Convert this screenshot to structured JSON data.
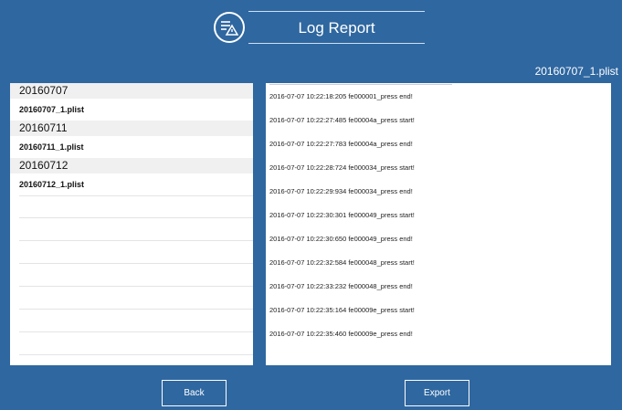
{
  "header": {
    "title": "Log Report",
    "logo_icon": "log-list-warning-icon"
  },
  "current_file": "20160707_1.plist",
  "file_groups": [
    {
      "date": "20160707",
      "files": [
        "20160707_1.plist"
      ]
    },
    {
      "date": "20160711",
      "files": [
        "20160711_1.plist"
      ]
    },
    {
      "date": "20160712",
      "files": [
        "20160712_1.plist"
      ]
    }
  ],
  "log_entries": [
    "2016-07-07 10:22:18:205 fe000001_press end!",
    "2016-07-07 10:22:27:485 fe00004a_press start!",
    "2016-07-07 10:22:27:783 fe00004a_press end!",
    "2016-07-07 10:22:28:724 fe000034_press start!",
    "2016-07-07 10:22:29:934 fe000034_press end!",
    "2016-07-07 10:22:30:301 fe000049_press start!",
    "2016-07-07 10:22:30:650 fe000049_press end!",
    "2016-07-07 10:22:32:584 fe000048_press start!",
    "2016-07-07 10:22:33:232 fe000048_press end!",
    "2016-07-07 10:22:35:164 fe00009e_press start!",
    "2016-07-07 10:22:35:460 fe00009e_press end!"
  ],
  "buttons": {
    "back": "Back",
    "export": "Export"
  },
  "colors": {
    "background": "#2f67a0",
    "panel": "#ffffff",
    "group_header": "#f0f0f0"
  }
}
